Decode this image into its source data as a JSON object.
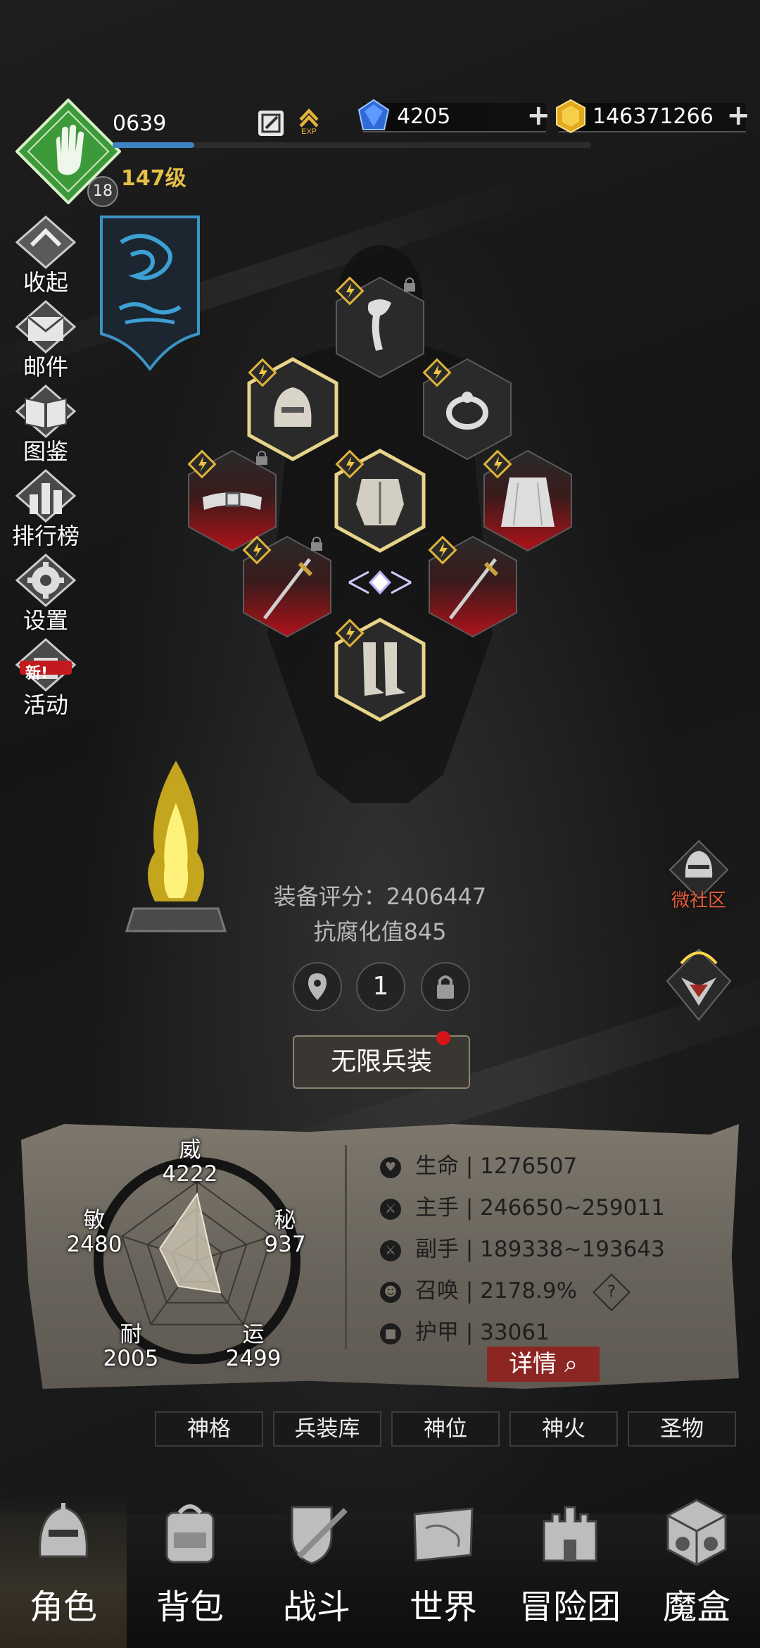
{
  "player": {
    "id": "0639",
    "level": "147级",
    "rank_badge": "18",
    "exp_progress": 0.17
  },
  "resources": {
    "gems": "4205",
    "gold": "146371266"
  },
  "side_menu": [
    {
      "label": "收起",
      "icon": "collapse-icon"
    },
    {
      "label": "邮件",
      "icon": "mail-icon"
    },
    {
      "label": "图鉴",
      "icon": "book-icon"
    },
    {
      "label": "排行榜",
      "icon": "ranking-icon"
    },
    {
      "label": "设置",
      "icon": "gear-icon"
    },
    {
      "label": "活动",
      "icon": "event-icon",
      "badge": "新!"
    }
  ],
  "equipment": [
    {
      "slot": "scarf",
      "icon": "scarf-icon"
    },
    {
      "slot": "helmet",
      "icon": "helmet-icon"
    },
    {
      "slot": "ring",
      "icon": "ring-icon"
    },
    {
      "slot": "belt",
      "icon": "belt-icon"
    },
    {
      "slot": "armor",
      "icon": "armor-icon"
    },
    {
      "slot": "cape",
      "icon": "cape-icon"
    },
    {
      "slot": "main-weapon",
      "icon": "sword-icon"
    },
    {
      "slot": "off-weapon",
      "icon": "sword-icon"
    },
    {
      "slot": "boots",
      "icon": "boots-icon"
    }
  ],
  "summary": {
    "score": "装备评分：2406447",
    "corruption": "抗腐化值845",
    "page": "1"
  },
  "infinite_button": "无限兵装",
  "right_buttons": {
    "community": "微社区"
  },
  "radar": {
    "wei": {
      "name": "威",
      "value": "4222"
    },
    "mi": {
      "name": "秘",
      "value": "937"
    },
    "yun": {
      "name": "运",
      "value": "2499"
    },
    "nai": {
      "name": "耐",
      "value": "2005"
    },
    "min": {
      "name": "敏",
      "value": "2480"
    }
  },
  "stats": [
    {
      "label": "生命",
      "sep": "|",
      "value": "1276507"
    },
    {
      "label": "主手",
      "sep": "|",
      "value": "246650~259011"
    },
    {
      "label": "副手",
      "sep": "|",
      "value": "189338~193643"
    },
    {
      "label": "召唤",
      "sep": "|",
      "value": "2178.9%"
    },
    {
      "label": "护甲",
      "sep": "|",
      "value": "33061"
    }
  ],
  "detail_button": "详情",
  "sub_tabs": [
    "神格",
    "兵装库",
    "神位",
    "神火",
    "圣物"
  ],
  "nav": [
    "角色",
    "背包",
    "战斗",
    "世界",
    "冒险团",
    "魔盒"
  ],
  "colors": {
    "level": "#e5c048",
    "exp": "#3b83c4",
    "detail": "#8c2622",
    "red_slot": "#b0121a",
    "gold_glow": "#e8d38a"
  }
}
